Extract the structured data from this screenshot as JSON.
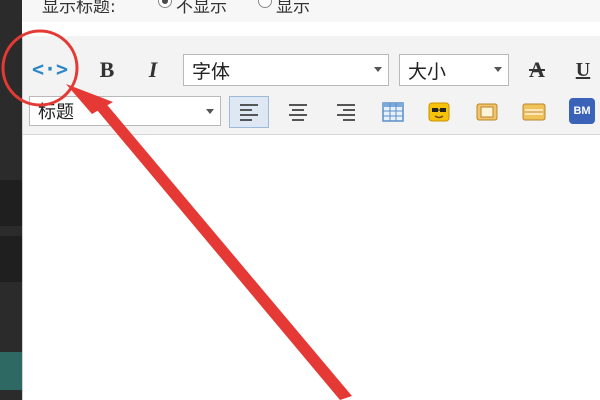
{
  "top_bar": {
    "label": "显示标题:",
    "options": [
      {
        "label": "不显示",
        "checked": true
      },
      {
        "label": "显示",
        "checked": false
      }
    ]
  },
  "toolbar": {
    "source_icon_glyph": "<·>",
    "bold_label": "B",
    "italic_label": "I",
    "font_select_value": "字体",
    "size_select_value": "大小",
    "strike_label": "A",
    "underline_label": "U",
    "heading_select_value": "标题",
    "bm_label": "BM"
  },
  "annotation": {
    "color": "#e53935"
  }
}
